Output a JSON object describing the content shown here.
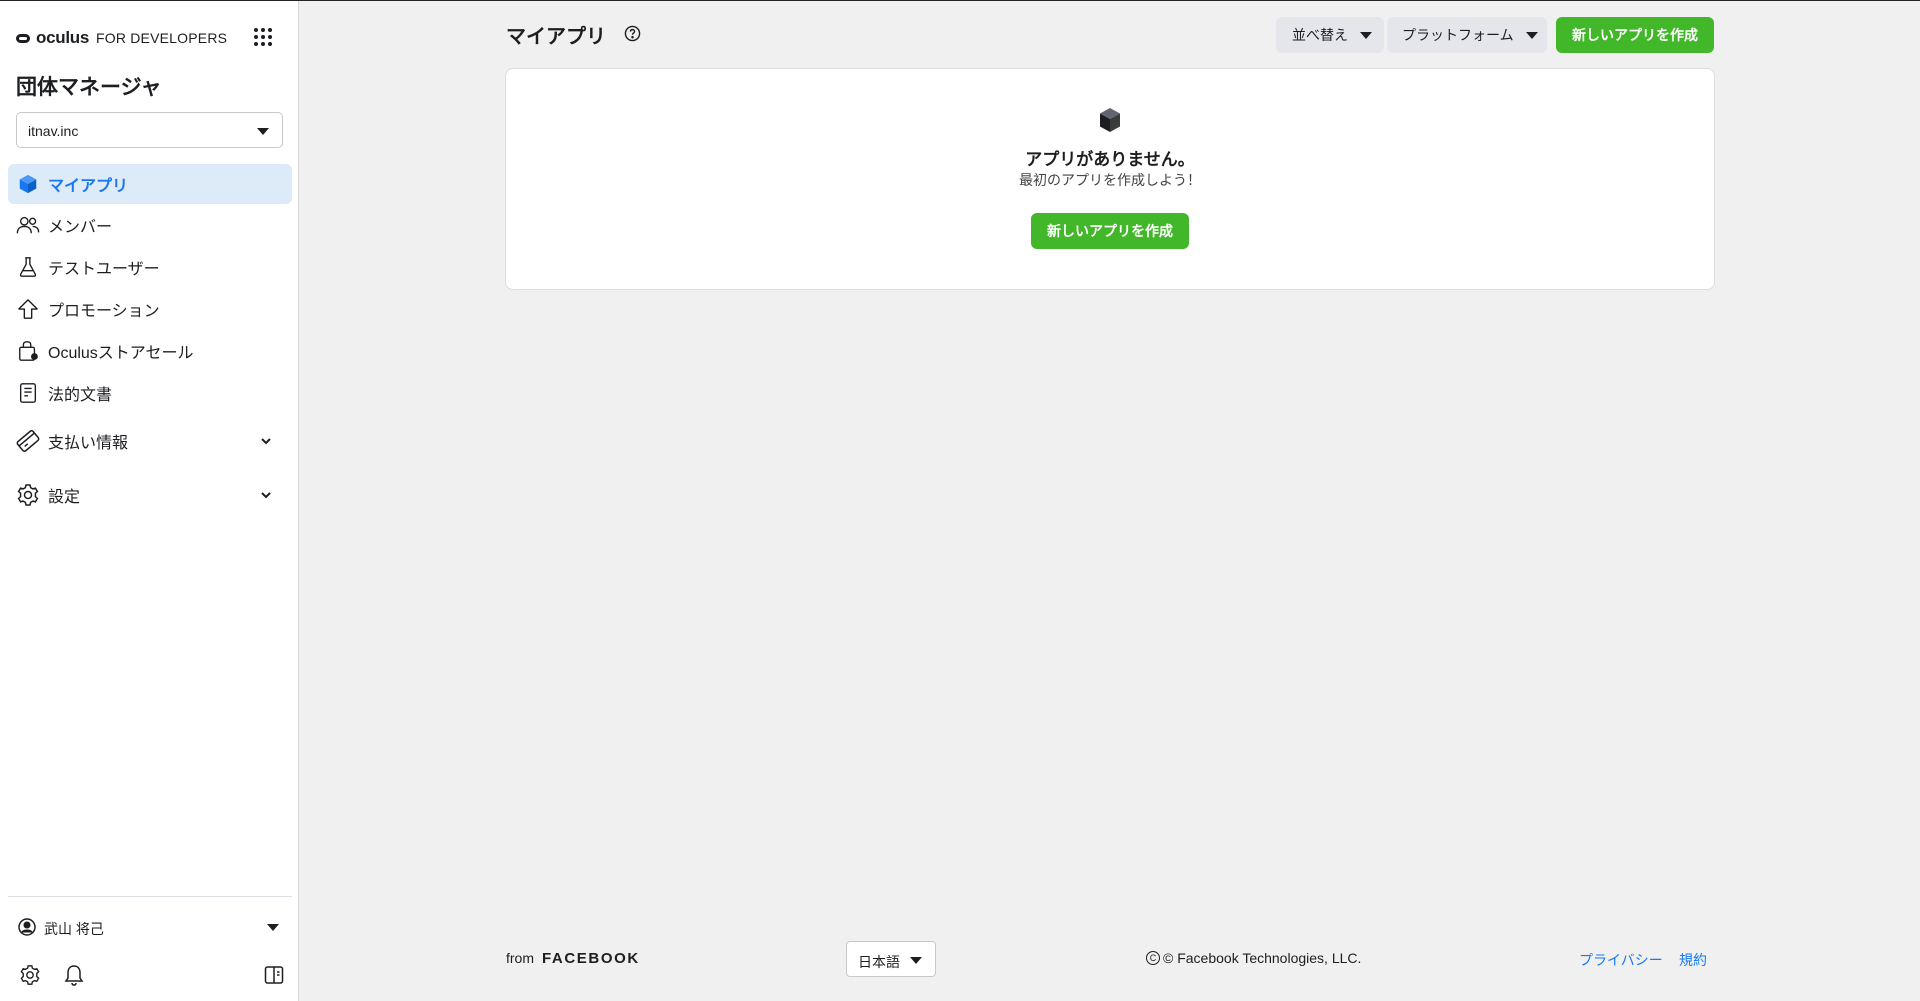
{
  "sidebar": {
    "brand": {
      "name": "oculus",
      "sub": "FOR DEVELOPERS"
    },
    "org_title": "団体マネージャ",
    "org_select": {
      "value": "itnav.inc"
    },
    "items": [
      {
        "label": "マイアプリ",
        "icon": "box-icon",
        "active": true
      },
      {
        "label": "メンバー",
        "icon": "people-icon"
      },
      {
        "label": "テストユーザー",
        "icon": "flask-icon"
      },
      {
        "label": "プロモーション",
        "icon": "up-arrow-icon"
      },
      {
        "label": "Oculusストアセール",
        "icon": "shopping-bag-icon"
      },
      {
        "label": "法的文書",
        "icon": "document-icon"
      },
      {
        "label": "支払い情報",
        "icon": "credit-card-icon",
        "expandable": true
      },
      {
        "label": "設定",
        "icon": "gear-icon",
        "expandable": true
      }
    ],
    "user": {
      "name": "武山 将己"
    }
  },
  "header": {
    "title": "マイアプリ",
    "sort_label": "並べ替え",
    "platform_label": "プラットフォーム",
    "create_label": "新しいアプリを作成"
  },
  "empty_state": {
    "title": "アプリがありません。",
    "subtitle": "最初のアプリを作成しよう！",
    "button_label": "新しいアプリを作成"
  },
  "footer": {
    "from": "from",
    "facebook": "FACEBOOK",
    "language": "日本語",
    "copyright": "© Facebook Technologies, LLC.",
    "privacy": "プライバシー",
    "terms": "規約"
  },
  "colors": {
    "accent_blue": "#1877f2",
    "active_bg": "#ddebf9",
    "green": "#42b72a",
    "page_bg": "#f0f0f0"
  }
}
